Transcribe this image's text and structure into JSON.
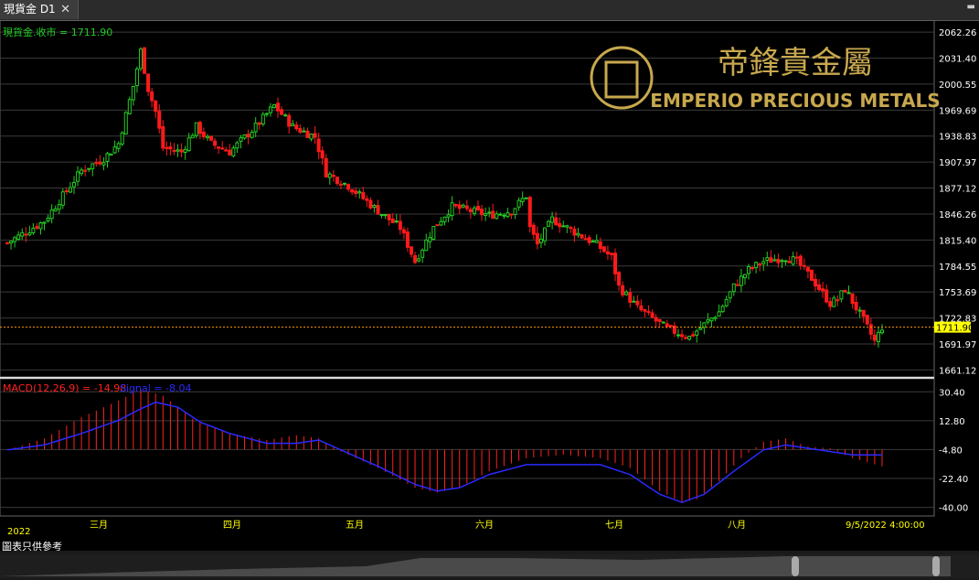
{
  "tab": {
    "title": "現貨金 D1",
    "close": "✕",
    "menu": "▬"
  },
  "logo": {
    "chinese": "帝鋒貴金屬",
    "english": "EMPERIO PRECIOUS METALS"
  },
  "colors": {
    "up": "#22cc22",
    "down": "#ff1a1a",
    "signal": "#2a2aff",
    "macd": "#ff2020",
    "grid": "#3a3a3a",
    "price_line": "#ff9900",
    "label_yellow": "#ffff00"
  },
  "footer": {
    "note": "圖表只供參考"
  },
  "chart_data": [
    {
      "type": "candlestick",
      "title": "現貨金.收市 = 1711.90",
      "ylim": [
        1655,
        2070
      ],
      "yticks": [
        2062.26,
        2031.4,
        2000.55,
        1969.69,
        1938.83,
        1907.97,
        1877.12,
        1846.26,
        1815.4,
        1784.55,
        1753.69,
        1722.83,
        1691.97,
        1661.12
      ],
      "current_price": 1711.9,
      "x_labels": [
        "2022",
        "三月",
        "四月",
        "五月",
        "六月",
        "七月",
        "八月",
        "9/5/2022 4:00:00"
      ],
      "close_points": [
        [
          0,
          1812
        ],
        [
          10,
          1838
        ],
        [
          20,
          1898
        ],
        [
          26,
          1912
        ],
        [
          30,
          1930
        ],
        [
          34,
          1998
        ],
        [
          36,
          2040
        ],
        [
          38,
          1995
        ],
        [
          40,
          1968
        ],
        [
          42,
          1925
        ],
        [
          47,
          1920
        ],
        [
          51,
          1950
        ],
        [
          55,
          1930
        ],
        [
          60,
          1920
        ],
        [
          67,
          1950
        ],
        [
          72,
          1975
        ],
        [
          77,
          1950
        ],
        [
          83,
          1938
        ],
        [
          86,
          1895
        ],
        [
          92,
          1880
        ],
        [
          100,
          1850
        ],
        [
          106,
          1830
        ],
        [
          110,
          1790
        ],
        [
          115,
          1830
        ],
        [
          120,
          1855
        ],
        [
          130,
          1845
        ],
        [
          136,
          1850
        ],
        [
          140,
          1868
        ],
        [
          141,
          1830
        ],
        [
          143,
          1810
        ],
        [
          147,
          1840
        ],
        [
          153,
          1825
        ],
        [
          159,
          1810
        ],
        [
          163,
          1795
        ],
        [
          165,
          1760
        ],
        [
          170,
          1735
        ],
        [
          178,
          1710
        ],
        [
          184,
          1700
        ],
        [
          188,
          1715
        ],
        [
          192,
          1730
        ],
        [
          196,
          1760
        ],
        [
          200,
          1780
        ],
        [
          204,
          1790
        ],
        [
          210,
          1795
        ],
        [
          213,
          1790
        ],
        [
          217,
          1770
        ],
        [
          222,
          1740
        ],
        [
          224,
          1745
        ],
        [
          226,
          1757
        ],
        [
          231,
          1720
        ],
        [
          234,
          1695
        ],
        [
          236,
          1712
        ]
      ]
    },
    {
      "type": "bar+line",
      "title": "MACD(12,26,9) = -14.98",
      "signal_label": "Signal = -8.04",
      "ylim": [
        -43,
        35
      ],
      "yticks": [
        30.4,
        12.8,
        -4.8,
        -22.4,
        -40.0
      ],
      "macd_points": [
        [
          0,
          -5
        ],
        [
          10,
          2
        ],
        [
          20,
          15
        ],
        [
          30,
          25
        ],
        [
          36,
          32
        ],
        [
          42,
          28
        ],
        [
          50,
          14
        ],
        [
          60,
          5
        ],
        [
          70,
          1
        ],
        [
          78,
          4
        ],
        [
          84,
          2
        ],
        [
          90,
          -6
        ],
        [
          100,
          -16
        ],
        [
          110,
          -28
        ],
        [
          116,
          -31
        ],
        [
          122,
          -28
        ],
        [
          130,
          -18
        ],
        [
          140,
          -10
        ],
        [
          150,
          -8
        ],
        [
          160,
          -10
        ],
        [
          168,
          -16
        ],
        [
          176,
          -30
        ],
        [
          182,
          -37
        ],
        [
          186,
          -35
        ],
        [
          192,
          -24
        ],
        [
          198,
          -10
        ],
        [
          204,
          0
        ],
        [
          210,
          2
        ],
        [
          216,
          -3
        ],
        [
          222,
          -4
        ],
        [
          228,
          -10
        ],
        [
          236,
          -15
        ]
      ],
      "signal_points": [
        [
          0,
          -5
        ],
        [
          10,
          -2
        ],
        [
          20,
          5
        ],
        [
          30,
          13
        ],
        [
          36,
          20
        ],
        [
          40,
          24
        ],
        [
          46,
          21
        ],
        [
          52,
          12
        ],
        [
          60,
          5
        ],
        [
          70,
          -1
        ],
        [
          78,
          -1
        ],
        [
          84,
          1
        ],
        [
          90,
          -5
        ],
        [
          100,
          -15
        ],
        [
          110,
          -26
        ],
        [
          116,
          -30
        ],
        [
          122,
          -28
        ],
        [
          130,
          -20
        ],
        [
          140,
          -14
        ],
        [
          150,
          -14
        ],
        [
          160,
          -14
        ],
        [
          168,
          -20
        ],
        [
          176,
          -32
        ],
        [
          182,
          -37
        ],
        [
          188,
          -32
        ],
        [
          196,
          -18
        ],
        [
          204,
          -5
        ],
        [
          210,
          -2
        ],
        [
          216,
          -4
        ],
        [
          222,
          -6
        ],
        [
          228,
          -8
        ],
        [
          236,
          -8
        ]
      ]
    }
  ]
}
